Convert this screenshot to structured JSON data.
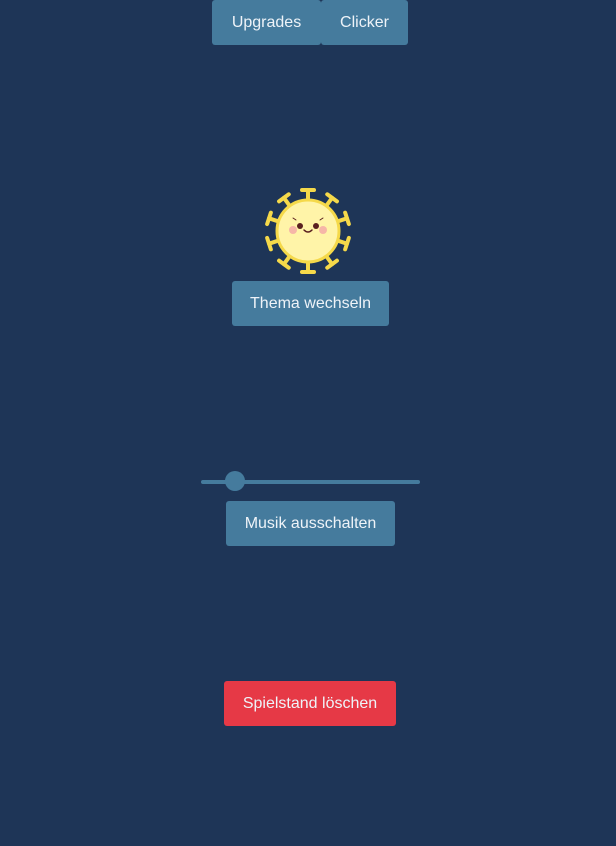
{
  "nav": {
    "upgrades_label": "Upgrades",
    "clicker_label": "Clicker"
  },
  "mascot": {
    "icon": "virus-sun-mascot-icon"
  },
  "theme": {
    "button_label": "Thema wechseln"
  },
  "music": {
    "volume_fraction": 0.12,
    "button_label": "Musik ausschalten"
  },
  "danger": {
    "delete_label": "Spielstand löschen"
  },
  "colors": {
    "background": "#1e3557",
    "button": "#457b9d",
    "danger": "#e63946",
    "mascot_body": "#fff4a8",
    "mascot_spikes": "#f5d94a"
  }
}
